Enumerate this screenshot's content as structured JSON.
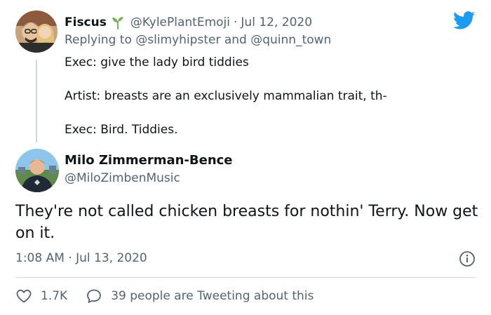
{
  "parent_tweet": {
    "name": "Fiscus",
    "handle": "@KylePlantEmoji",
    "separator": "·",
    "date": "Jul 12, 2020",
    "replying_prefix": "Replying to",
    "replying_to_1": "@slimyhipster",
    "replying_and": "and",
    "replying_to_2": "@quinn_town",
    "lines": [
      "Exec: give the lady bird tiddies",
      "Artist: breasts are an exclusively mammalian trait, th-",
      "Exec: Bird. Tiddies."
    ]
  },
  "main_tweet": {
    "name": "Milo Zimmerman-Bence",
    "handle": "@MiloZimbenMusic",
    "text": "They're not called chicken breasts for nothin' Terry. Now get on it.",
    "time": "1:08 AM · Jul 13, 2020",
    "likes": "1.7K",
    "tweeting_about": "39 people are Tweeting about this"
  },
  "icons": {
    "brand": "twitter-bird-icon",
    "sprout": "sprout-icon",
    "like": "heart-icon",
    "reply": "speech-bubble-icon",
    "info": "info-icon"
  },
  "colors": {
    "brand_blue": "#1d9bf0",
    "sprout_green": "#78b159",
    "text_primary": "#0f1419",
    "text_secondary": "#536471",
    "divider": "#cfd9de"
  }
}
